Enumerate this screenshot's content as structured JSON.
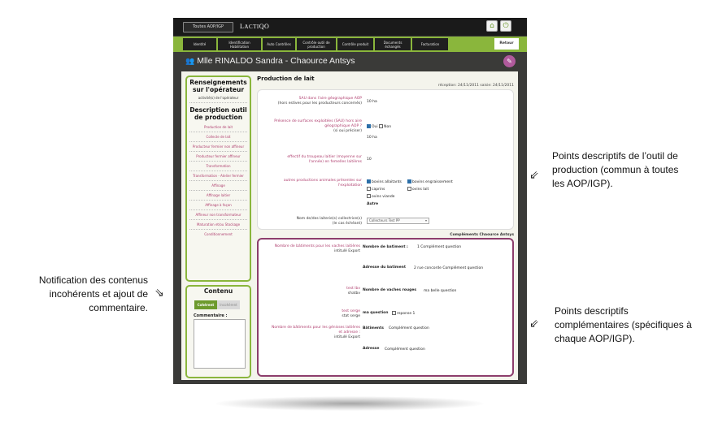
{
  "app": {
    "aop_button": "Toutes AOP/IGP",
    "logo_a": "L",
    "logo_b": "ACTI",
    "logo_c": "QO",
    "home_icon": "home-icon",
    "power_icon": "power-icon"
  },
  "nav": {
    "items": [
      "Identité",
      "Identification Habilitation",
      "Auto Contrôles",
      "Contrôle outil de production",
      "Contrôle produit",
      "Documents échangés",
      "Facturation"
    ],
    "retour": "Retour"
  },
  "page": {
    "title": "Mlle RINALDO Sandra - Chaource Antsys"
  },
  "sidebar": {
    "heading1_line1": "Renseignements",
    "heading1_line2": "sur l'opérateur",
    "link_activites": "activité(s) de l'opérateur",
    "heading2_line1": "Description outil",
    "heading2_line2": "de production",
    "links": [
      "Production de lait",
      "Collecte de lait",
      "Producteur fermier non affineur",
      "Producteur fermier affineur",
      "Transformation",
      "Transformation - Atelier fermier",
      "Affinage",
      "Affinage laitier",
      "Affinage à façon",
      "Affineur non transformateur",
      "Maturation et/ou Stockage",
      "Conditionnement"
    ]
  },
  "contenu": {
    "title": "Contenu",
    "btn_active": "Cohérent",
    "btn_inactive": "Incohérent",
    "comment_label": "Commentaire :"
  },
  "main": {
    "title": "Production de lait",
    "reception": "réception: 24/11/2011 saisie: 24/11/2011",
    "q1_line1": "SAU dans l'aire géographique AOP",
    "q1_line2": "(hors estives pour les producteurs concernés)",
    "a1": "10 ha",
    "q2_line1": "Présence de surfaces exploitées (SAU) hors aire",
    "q2_line2": "géographique AOP ?",
    "q2_line3": "(si oui préciser)",
    "a2_oui": "Oui",
    "a2_non": "Non",
    "a2_value": "10 ha",
    "q3_line1": "effectif du troupeau laitier (moyenne sur",
    "q3_line2": "l'année) en femelles laitières",
    "a3": "10",
    "q4_line1": "autres productions animales présentes sur",
    "q4_line2": "l'exploitation",
    "opt_bovins_allaitants": "bovins allaitants",
    "opt_bovins_engraissement": "bovins engraissement",
    "opt_caprins": "caprins",
    "opt_ovins_lait": "ovins lait",
    "opt_ovins_viande": "ovins viande",
    "opt_autre": "Autre",
    "q5_line1": "Nom de/des laiterie(s) collectrice(s)",
    "q5_line2": "(le cas échéant)",
    "a5": "Collecteurs Test PP",
    "complements_title": "Compléments Chaource Antsys",
    "c1_line1": "Nombre de bâtiments pour les vaches laitières",
    "c1_line2": "intitulé Export",
    "c1_label": "Nombre de batiment :",
    "c1_value": "1 Complément question",
    "c2_label": "Adresse du batiment",
    "c2_value": "2 rue concorde Complément question",
    "c3_line1": "test lbv",
    "c3_line2": "shatbv",
    "c3_label": "Nombre de vaches rouges",
    "c3_value": "ma belle question",
    "c4_line1": "test serge",
    "c4_line2": "stat serge",
    "c4_label": "ma question",
    "c4_value": "reponse 1",
    "c5_line1": "Nombre de bâtiments pour les génisses laitières",
    "c5_line2": "et adresse :",
    "c5_line3": "intitulé Export",
    "c5_label": "Bâtiments",
    "c5_value": "Complément question",
    "c6_label": "Adresse",
    "c6_value": "Complément question"
  },
  "annotations": {
    "left_1": "Notification des contenus",
    "left_2": "incohérents et ajout de",
    "left_3": "commentaire.",
    "right_top_1": "Points descriptifs de l’outil de",
    "right_top_2": "production (commun à toutes",
    "right_top_3": "les AOP/IGP).",
    "right_bottom_1": "Points descriptifs",
    "right_bottom_2": "complémentaires (spécifiques à",
    "right_bottom_3": "chaque AOP/IGP)."
  }
}
